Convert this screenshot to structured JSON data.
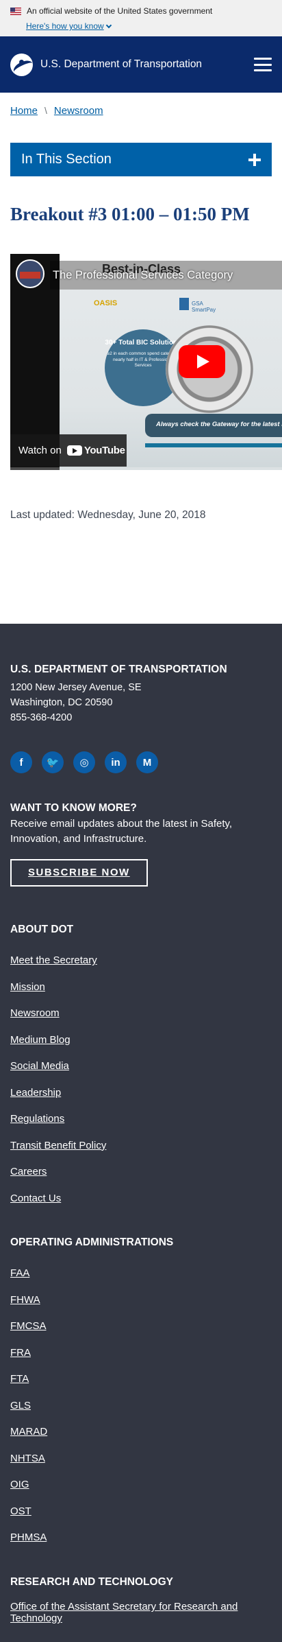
{
  "gov_banner": {
    "official_text": "An official website of the United States government",
    "how_you_know": "Here's how you know"
  },
  "header": {
    "site_name": "U.S. Department of Transportation"
  },
  "breadcrumb": {
    "items": [
      "Home",
      "Newsroom"
    ]
  },
  "section_nav": {
    "label": "In This Section"
  },
  "page": {
    "title": "Breakout #3 01:00 – 01:50 PM",
    "last_updated": "Last updated: Wednesday, June 20, 2018"
  },
  "video": {
    "title": "The Professional Services Category",
    "slide_heading": "Best-in-Class",
    "slide_bic_title": "30+ Total BIC Solutions",
    "slide_bic_text": "≥2 in each common spend category; nearly half in IT & Professional Services",
    "slide_oasis": "OASIS",
    "slide_gsa": "GSA SmartPay",
    "slide_gateway": "Always check the Gateway for the latest informati",
    "watch_on": "Watch on",
    "youtube": "YouTube",
    "progress_fraction": 0.0
  },
  "footer": {
    "org": "U.S. DEPARTMENT OF TRANSPORTATION",
    "address_line1": "1200 New Jersey Avenue, SE",
    "address_line2": "Washington, DC 20590",
    "phone": "855-368-4200",
    "social": [
      {
        "name": "facebook-icon",
        "glyph": "f"
      },
      {
        "name": "twitter-icon",
        "glyph": "🐦"
      },
      {
        "name": "instagram-icon",
        "glyph": "◎"
      },
      {
        "name": "linkedin-icon",
        "glyph": "in"
      },
      {
        "name": "medium-icon",
        "glyph": "M"
      }
    ],
    "want_to_know": {
      "heading": "WANT TO KNOW MORE?",
      "text": "Receive email updates about the latest in Safety, Innovation, and Infrastructure.",
      "button": "SUBSCRIBE NOW"
    },
    "about": {
      "heading": "ABOUT DOT",
      "links": [
        "Meet the Secretary",
        "Mission",
        "Newsroom",
        "Medium Blog",
        "Social Media",
        "Leadership",
        "Regulations",
        "Transit Benefit Policy",
        "Careers",
        "Contact Us"
      ]
    },
    "operating_admins": {
      "heading": "OPERATING ADMINISTRATIONS",
      "links": [
        "FAA",
        "FHWA",
        "FMCSA",
        "FRA",
        "FTA",
        "GLS",
        "MARAD",
        "NHTSA",
        "OIG",
        "OST",
        "PHMSA"
      ]
    },
    "research": {
      "heading": "RESEARCH AND TECHNOLOGY",
      "links": [
        "Office of the Assistant Secretary for Research and Technology"
      ]
    }
  },
  "colors": {
    "header_bg": "#0b2a6b",
    "section_nav_bg": "#0061a8",
    "title_color": "#1a3f7a",
    "link_color": "#005ea2",
    "footer_bg": "#323642",
    "social_bg": "#0b5da7",
    "youtube_red": "#ff0000"
  }
}
